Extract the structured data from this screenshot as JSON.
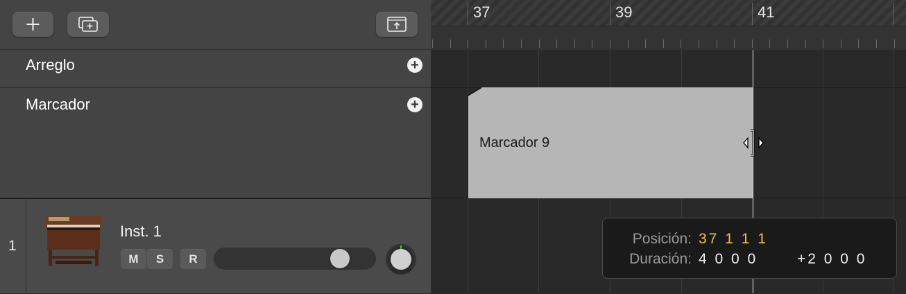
{
  "header": {
    "add_track_icon": "plus-icon",
    "new_track_stack_icon": "track-stack-icon",
    "upload_icon": "upload-icon"
  },
  "ruler": {
    "bar_numbers": [
      "37",
      "39",
      "41"
    ]
  },
  "global_tracks": [
    {
      "label": "Arreglo"
    },
    {
      "label": "Marcador"
    }
  ],
  "marker_region": {
    "name": "Marcador 9",
    "color": "#b6b6b6"
  },
  "track": {
    "number": "1",
    "name": "Inst. 1",
    "mute_label": "M",
    "solo_label": "S",
    "record_label": "R",
    "volume_level": 0.82,
    "pan_icon": "pan-knob-icon"
  },
  "tooltip": {
    "position_label": "Posición:",
    "position_value": "37 1 1 1",
    "duration_label": "Duración:",
    "duration_value": "4 0 0 0",
    "delta_value": "+2 0 0 0",
    "position_color": "#e8c251"
  }
}
